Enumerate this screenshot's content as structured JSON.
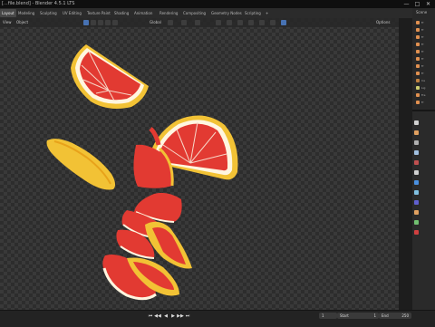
{
  "window": {
    "title": "[...file.blend] - Blender 4.5.1 LTS",
    "controls": [
      "—",
      "□",
      "✕"
    ]
  },
  "workspaces": [
    "Layout",
    "Modeling",
    "Sculpting",
    "UV Editing",
    "Texture Paint",
    "Shading",
    "Animation",
    "Rendering",
    "Compositing",
    "Geometry Nodes",
    "Scripting",
    "+"
  ],
  "active_workspace": "Layout",
  "viewport_header": {
    "menus": [
      "View",
      "Object"
    ],
    "transform_space": "Global",
    "options_label": "Options"
  },
  "outliner": {
    "header": "Scene",
    "rows": [
      {
        "label": "Fr",
        "icon_color": "#e09050"
      },
      {
        "label": "Fr",
        "icon_color": "#e09050"
      },
      {
        "label": "Fr",
        "icon_color": "#e09050"
      },
      {
        "label": "Fr",
        "icon_color": "#e09050"
      },
      {
        "label": "Fr",
        "icon_color": "#e09050"
      },
      {
        "label": "Fr",
        "icon_color": "#e09050"
      },
      {
        "label": "Fr",
        "icon_color": "#e09050"
      },
      {
        "label": "Fr",
        "icon_color": "#e09050"
      },
      {
        "label": "Ca",
        "icon_color": "#c08040"
      },
      {
        "label": "Lig",
        "icon_color": "#cccc70"
      },
      {
        "label": "Fre",
        "icon_color": "#e09050"
      },
      {
        "label": "Fr",
        "icon_color": "#e09050"
      }
    ]
  },
  "properties": {
    "tab_colors": [
      "#d0d0d0",
      "#e0a060",
      "#b0b0b0",
      "#a0c0e0",
      "#c05050",
      "#d0d0d0",
      "#4a90e0",
      "#80c0e0",
      "#6060d0",
      "#e0a060",
      "#70c070",
      "#d04040"
    ]
  },
  "timeline": {
    "playback_icons": [
      "⏮",
      "◀◀",
      "◀",
      "▶",
      "▶▶",
      "⏭"
    ],
    "start_label": "Start",
    "start_value": "1",
    "end_label": "End",
    "end_value": "250",
    "current_frame": "1"
  },
  "colors": {
    "accent": "#4772b3",
    "rind": "#f2c235",
    "flesh": "#e23a32",
    "pith": "#fff6e0"
  }
}
